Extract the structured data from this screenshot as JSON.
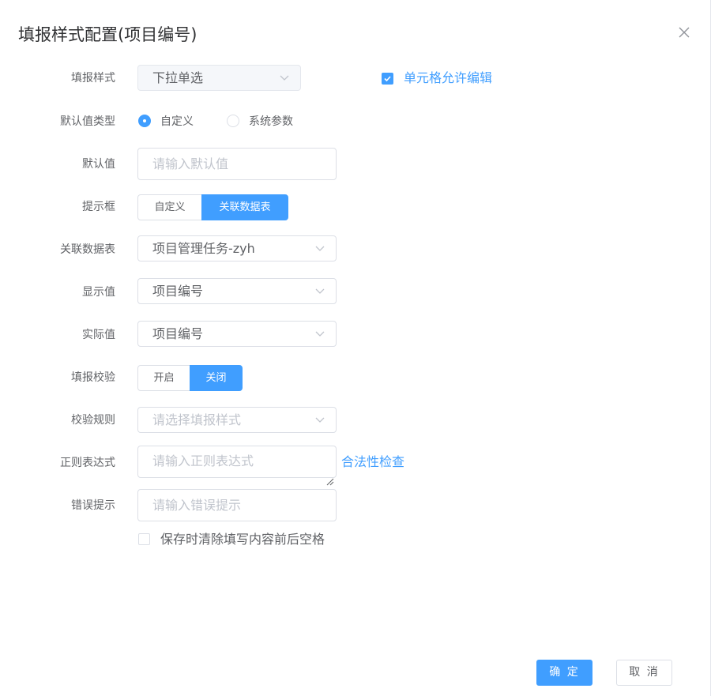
{
  "dialog": {
    "title": "填报样式配置(项目编号)"
  },
  "form": {
    "fill_style": {
      "label": "填报样式",
      "value": "下拉单选"
    },
    "cell_editable": {
      "label": "单元格允许编辑",
      "checked": true
    },
    "default_type": {
      "label": "默认值类型",
      "options": [
        {
          "label": "自定义",
          "checked": true
        },
        {
          "label": "系统参数",
          "checked": false
        }
      ]
    },
    "default_value": {
      "label": "默认值",
      "placeholder": "请输入默认值"
    },
    "hint_box": {
      "label": "提示框",
      "options": [
        {
          "label": "自定义",
          "active": false
        },
        {
          "label": "关联数据表",
          "active": true
        }
      ]
    },
    "linked_table": {
      "label": "关联数据表",
      "value": "项目管理任务-zyh"
    },
    "display_value": {
      "label": "显示值",
      "value": "项目编号"
    },
    "actual_value": {
      "label": "实际值",
      "value": "项目编号"
    },
    "validation": {
      "label": "填报校验",
      "options": [
        {
          "label": "开启",
          "active": false
        },
        {
          "label": "关闭",
          "active": true
        }
      ]
    },
    "validation_rule": {
      "label": "校验规则",
      "placeholder": "请选择填报样式"
    },
    "regex": {
      "label": "正则表达式",
      "placeholder": "请输入正则表达式",
      "check_link": "合法性检查"
    },
    "error_hint": {
      "label": "错误提示",
      "placeholder": "请输入错误提示"
    },
    "trim_on_save": {
      "label": "保存时清除填写内容前后空格",
      "checked": false
    }
  },
  "footer": {
    "confirm": "确 定",
    "cancel": "取 消"
  },
  "colors": {
    "accent": "#409eff",
    "text": "#606266",
    "placeholder": "#c0c4cc",
    "border": "#dcdfe6"
  },
  "icons": [
    "close-icon",
    "chevron-down-icon",
    "check-icon",
    "resize-handle-icon"
  ]
}
